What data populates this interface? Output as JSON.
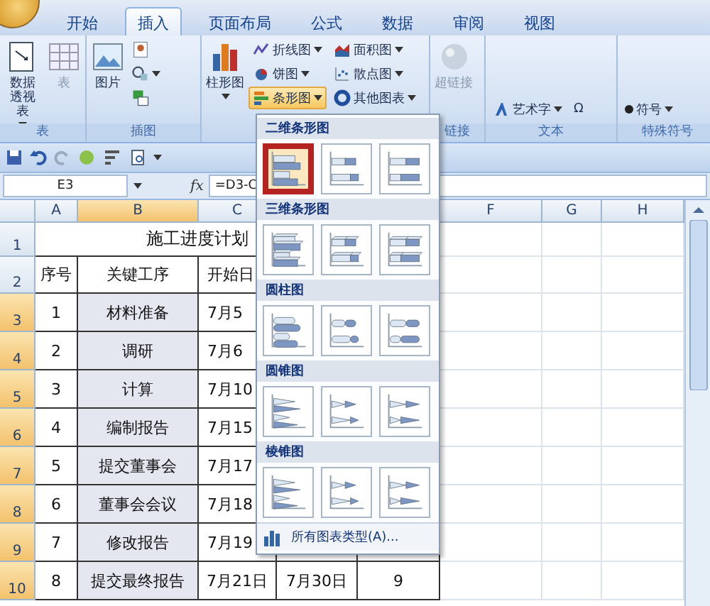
{
  "tabs": [
    {
      "label": "开始",
      "selected": false
    },
    {
      "label": "插入",
      "selected": true
    },
    {
      "label": "页面布局",
      "selected": false
    },
    {
      "label": "公式",
      "selected": false
    },
    {
      "label": "数据",
      "selected": false
    },
    {
      "label": "审阅",
      "selected": false
    },
    {
      "label": "视图",
      "selected": false
    }
  ],
  "ribbon_groups": [
    {
      "label": "表",
      "items": [
        {
          "kind": "large",
          "label": "数据透视表",
          "dropdown": true,
          "disabled": false
        },
        {
          "kind": "large",
          "label": "表",
          "dropdown": false,
          "disabled": true
        }
      ]
    },
    {
      "label": "插图",
      "items": [
        {
          "kind": "large",
          "label": "图片",
          "dropdown": false,
          "disabled": false
        },
        {
          "kind": "icon",
          "dropdown": false,
          "disabled": false
        },
        {
          "kind": "icon",
          "dropdown": true,
          "disabled": false
        },
        {
          "kind": "icon",
          "dropdown": false,
          "disabled": false
        }
      ]
    },
    {
      "items": [
        {
          "kind": "large",
          "label": "柱形图",
          "dropdown": true,
          "disabled": false,
          "open": false
        },
        {
          "kind": "small",
          "label": "折线图",
          "dropdown": true,
          "disabled": false,
          "open": false
        },
        {
          "kind": "small",
          "label": "饼图",
          "dropdown": true,
          "disabled": false,
          "open": false
        },
        {
          "kind": "small",
          "label": "条形图",
          "dropdown": true,
          "disabled": false,
          "open": true
        },
        {
          "kind": "small",
          "label": "面积图",
          "dropdown": true,
          "disabled": false,
          "open": false
        },
        {
          "kind": "small",
          "label": "散点图",
          "dropdown": true,
          "disabled": false,
          "open": false
        },
        {
          "kind": "small",
          "label": "其他图表",
          "dropdown": true,
          "disabled": false,
          "open": false
        }
      ]
    },
    {
      "label": "链接",
      "items": [
        {
          "kind": "large",
          "label": "超链接",
          "dropdown": false,
          "disabled": true
        }
      ]
    },
    {
      "label": "文本",
      "items": [
        {
          "kind": "small",
          "label": "艺术字",
          "dropdown": true,
          "disabled": false
        },
        {
          "kind": "small",
          "label": "Ω",
          "dropdown": false,
          "disabled": false
        }
      ]
    },
    {
      "label": "特殊符号",
      "items": [
        {
          "kind": "small",
          "label": "符号",
          "dropdown": true,
          "disabled": false
        }
      ]
    }
  ],
  "formula_bar": {
    "name_box": "E3",
    "fx": "fx",
    "formula": "=D3-C"
  },
  "columns": [
    {
      "label": "A",
      "selected": false
    },
    {
      "label": "B",
      "selected": true
    },
    {
      "label": "C",
      "selected": false
    },
    {},
    {},
    {
      "label": "F",
      "selected": false
    },
    {
      "label": "G",
      "selected": false
    },
    {
      "label": "H",
      "selected": false
    }
  ],
  "rows": [
    {
      "header": "1",
      "selected": false,
      "title": "施工进度计划"
    },
    {
      "header": "2",
      "selected": false,
      "cells": [
        "序号",
        "关键工序",
        "开始日"
      ]
    },
    {
      "header": "3",
      "selected": true,
      "cells": [
        "1",
        "材料准备",
        "7月5"
      ]
    },
    {
      "header": "4",
      "selected": true,
      "cells": [
        "2",
        "调研",
        "7月6"
      ]
    },
    {
      "header": "5",
      "selected": true,
      "cells": [
        "3",
        "计算",
        "7月10"
      ]
    },
    {
      "header": "6",
      "selected": true,
      "cells": [
        "4",
        "编制报告",
        "7月15"
      ]
    },
    {
      "header": "7",
      "selected": true,
      "cells": [
        "5",
        "提交董事会",
        "7月17"
      ]
    },
    {
      "header": "8",
      "selected": true,
      "cells": [
        "6",
        "董事会会议",
        "7月18"
      ]
    },
    {
      "header": "9",
      "selected": true,
      "cells": [
        "7",
        "修改报告",
        "7月19"
      ]
    },
    {
      "header": "10",
      "selected": true,
      "cells": [
        "8",
        "提交最终报告",
        "7月21日",
        "7月30日",
        "9"
      ]
    }
  ],
  "chart_menu": {
    "sections": [
      {
        "title": "二维条形图",
        "kind": "flat",
        "options": [
          {
            "kind": "clustered",
            "selected": true
          },
          {
            "kind": "stacked",
            "selected": false
          },
          {
            "kind": "percent",
            "selected": false
          }
        ]
      },
      {
        "title": "三维条形图",
        "kind": "box",
        "options": [
          {
            "kind": "clustered",
            "selected": false
          },
          {
            "kind": "stacked",
            "selected": false
          },
          {
            "kind": "percent",
            "selected": false
          }
        ]
      },
      {
        "title": "圆柱图",
        "kind": "cylinder",
        "options": [
          {
            "kind": "clustered",
            "selected": false
          },
          {
            "kind": "stacked",
            "selected": false
          },
          {
            "kind": "percent",
            "selected": false
          }
        ]
      },
      {
        "title": "圆锥图",
        "kind": "cone",
        "options": [
          {
            "kind": "clustered",
            "selected": false
          },
          {
            "kind": "stacked",
            "selected": false
          },
          {
            "kind": "percent",
            "selected": false
          }
        ]
      },
      {
        "title": "棱锥图",
        "kind": "pyramid",
        "options": [
          {
            "kind": "clustered",
            "selected": false
          },
          {
            "kind": "stacked",
            "selected": false
          },
          {
            "kind": "percent",
            "selected": false
          }
        ]
      }
    ],
    "footer": "所有图表类型(A)..."
  }
}
